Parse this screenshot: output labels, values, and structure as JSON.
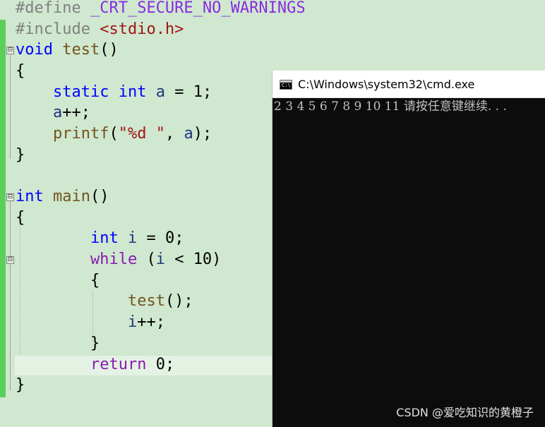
{
  "editor": {
    "lines": {
      "l1": {
        "a": "#define ",
        "b": "_CRT_SECURE_NO_WARNINGS"
      },
      "l2": {
        "a": "#include ",
        "b": "<stdio.h>"
      },
      "l3": {
        "kw": "void",
        "fn": "test",
        "rest": "()"
      },
      "l4": "{",
      "l5": {
        "kw1": "static",
        "kw2": "int",
        "var": "a",
        "rest": " = 1;"
      },
      "l6": {
        "var": "a",
        "rest": "++;"
      },
      "l7": {
        "fn": "printf",
        "p1": "(",
        "str": "\"%d \"",
        "p2": ", ",
        "var": "a",
        "p3": ");"
      },
      "l8": "}",
      "l9": {
        "kw": "int",
        "fn": "main",
        "rest": "()"
      },
      "l10": "{",
      "l11": {
        "kw": "int",
        "var": "i",
        "rest": " = 0;"
      },
      "l12": {
        "kw": "while",
        "p1": " (",
        "var": "i",
        "rest": " < 10)"
      },
      "l13": "{",
      "l14": {
        "fn": "test",
        "rest": "();"
      },
      "l15": {
        "var": "i",
        "rest": "++;"
      },
      "l16": "}",
      "l17": {
        "kw": "return",
        "rest": " 0;"
      },
      "l18": "}"
    },
    "collapse_glyph": "⊟"
  },
  "console": {
    "title": "C:\\Windows\\system32\\cmd.exe",
    "icon": "cmd-window-icon",
    "icon_text": "C:\\",
    "output": "2 3 4 5 6 7 8 9 10 11 请按任意键继续. . ."
  },
  "watermark": "CSDN @爱吃知识的黄橙子",
  "colors": {
    "editor_bg": "#cfe8cf",
    "keyword": "#0000ff",
    "control_keyword": "#8a1bb0",
    "string": "#a31515",
    "function": "#74531f",
    "variable": "#1f377f",
    "console_bg": "#0c0c0c",
    "console_text": "#c0c0c0"
  }
}
